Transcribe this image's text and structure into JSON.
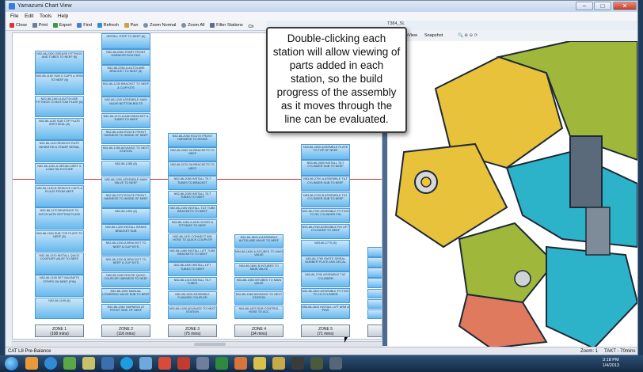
{
  "window": {
    "title": "Yamazumi Chart View",
    "controls": {
      "minimize": "–",
      "maximize": "□",
      "close": "✕"
    }
  },
  "menu": [
    "File",
    "Edit",
    "Tools",
    "Help"
  ],
  "toolbar": [
    "Close",
    "Print",
    "Export",
    "Find",
    "Refresh",
    "Pan",
    "Zoom Normal",
    "Zoom All",
    "Filter Stations",
    "Ch"
  ],
  "right_toolbar": {
    "tab": "T384_SL",
    "tree_view": "TreeView",
    "snapshot": "Snapshot"
  },
  "callout": "Double-clicking each station will allow viewing of parts added in each station, so the build progress of the assembly as it moves through the line can be evaluated.",
  "zones": [
    {
      "label": "ZONE 1",
      "time": "(108 mins)"
    },
    {
      "label": "ZONE 2",
      "time": "(116 mins)"
    },
    {
      "label": "ZONE 3",
      "time": "(75 mins)"
    },
    {
      "label": "ZONE 4",
      "time": "(34 mins)"
    },
    {
      "label": "ZONE 5",
      "time": "(71 mins)"
    }
  ],
  "columns": [
    {
      "tiles": [
        "N52-86-2300 GREASE FITTINGS AND TUBES TO NEEF (6)",
        "N52-86-1160 SUB D CAPS & SHIN TO NEEF (6)",
        "N52-86-1160-A AUTOLUBE FITTINGS TO BOTTOM PLATE (8)",
        "N52-86-1140 SUB TOP PLATE WITH SEAL (8)",
        "N52-86-1120 REMOVE RUST INHIBITOR & STAMP SERIAL",
        "N52-86-1150-A OBTAIN NEEF & LOAD ON FIXTURE",
        "N52-86-1150-B REMOVE CAPS & PLUGS FROM NEEF",
        "N52-86-1170 BEARINGS TO HITCH WITH BOTTOM PLATE",
        "N52-86-1180 SUB TOP PLATE TO NEEF (8)",
        "N52-86-1210 INSTALL QUICK COUPLER VALVE TO NEEF",
        "N52-86-1190 SET MAGNETS STRIPS ON NEEF (PIN)",
        "N52-86-1195 (8)"
      ]
    },
    {
      "tiles": [
        "INSTALL STEP TO NEEF (6)",
        "N52-86-2260 START FRONT HARNESS ROUTING",
        "N52-86-2260-A AUTOLUBE BRACKET TO NEEF (8)",
        "N52-86-1230 BRACKET TO NEEF & CLIP KITS",
        "N52-86-1240 ASSEMBLE MAIN VALVE BOTTOM BOLTS",
        "N52-86-1270-A ADD BRACKET & TUBES TO NEEF",
        "N52-86-1260 ROUTE FRONT HARNESS TO INSIDE OF NEEF",
        "N52-86-1280 ADVANCE TO NEXT STATION",
        "N52-86-1285 (8)",
        "N52-86-1290 ASSEMBLE MAIN VALVE TO NEEF",
        "N52-86-2270 ROUTE FRONT HARNESS TO INSIDE OF NEEF",
        "N52-86-1300 (8)",
        "N52-86-1320 INSTALL BRAKE BRACKET SUB",
        "N52-86-1330-A BRACKET TO NEEF & CLIP KITS",
        "N52-86-1330-B BRACKET TO NEEF & CLIP KITS",
        "N52-86-1340 ROUTE QUICK COUPLER HARNESS TO NEEF",
        "N52-86-1350 MANUAL LOWERING VALVE SUB TO NEEF",
        "N52-86-1360 HARNESS AT FRONT SIDE OF NEEF"
      ]
    },
    {
      "tiles": [
        "N52-86-2050 ROUTE FRONT HARNESS TO INSIDE",
        "N52-86-2060 SA BRACKETS TO NEEF",
        "N52-86-2070 SA BRACKETS TO NEEF",
        "N52-86-2080 INSTALL TILT TUBES TO BRACKET",
        "N52-86-2090 INSTALL TILT TUBES TO NEEF",
        "N52-86-2100 INSTALL TILT TUBE BRACKETS TO NEEF",
        "N52-86-1460-A ADD HOSES & FITTINGS TO NEEF",
        "N52-86-1470 CONNECT BIG HOSE TO QUICK COUPLER",
        "N52-86-1480 INSTALL LIFT TUBE BRACKETS TO NEEF",
        "N52-86-1490 INSTALL LIFT TUBES TO NEEF",
        "N52-86-1410 INSTALL TILT TUBES",
        "N52-86-1420 ASSEMBLE FLANGED COUPLER",
        "N52-86-1430 ADVANCE TO NEXT STATION"
      ]
    },
    {
      "tiles": [
        "N54-86-1800-A ASSEMBLE AUTOLUBE VALVE TO NEEF",
        "N54-86-1840-A INTUBES TO MAIN VALVE",
        "N54-86-1840-B INTUBES TO MAIN VALVE",
        "N54-86-1850 INTUBES TO MAIN VALVE",
        "N54-86-1860 ADVANCE TO NEXT STATION",
        "N54-86-1870 SUB CONTROL HOSE TO ACC"
      ]
    },
    {
      "tiles": [
        "N53-86-2600 ASSEMBLE PLATE TO TOP OF NEEF",
        "N53-86-2650 INSTALL TILT CYLINDER SUB TO NEEF",
        "N53-86-2700-A ASSEMBLE TILT CYLINDER SUB TO NEEF",
        "N53-86-2700-B ASSEMBLE TILT CYLINDER SUB TO NEEF",
        "N53-86-2750 ASSEMBLE FITTING TO RH CYLINDER PIN",
        "N53-86-2760 ASSEMBLE RH LIFT CYLINDER TO NEEF",
        "N53-86-2770 (8)",
        "N53-86-2780 PASTE SERIAL NUMBER PLATE AND DECAL",
        "N53-86-2790 ASSEMBLE TILT CYLINDER",
        "N53-86-2800 ASSEMBLE FITTING TO LH CYLINDER",
        "N53-86-2810 INSTALL LIFT ARM & PINS"
      ]
    },
    {
      "tiles": [
        "Required",
        "",
        "",
        "",
        "",
        "",
        ""
      ]
    }
  ],
  "status": {
    "left": "CAT L8 Pre-Balance",
    "zoom": "Zoom: 1",
    "takt": "TAKT - 70mins"
  },
  "clock": {
    "time": "3:18 PM",
    "date": "1/4/2013"
  }
}
